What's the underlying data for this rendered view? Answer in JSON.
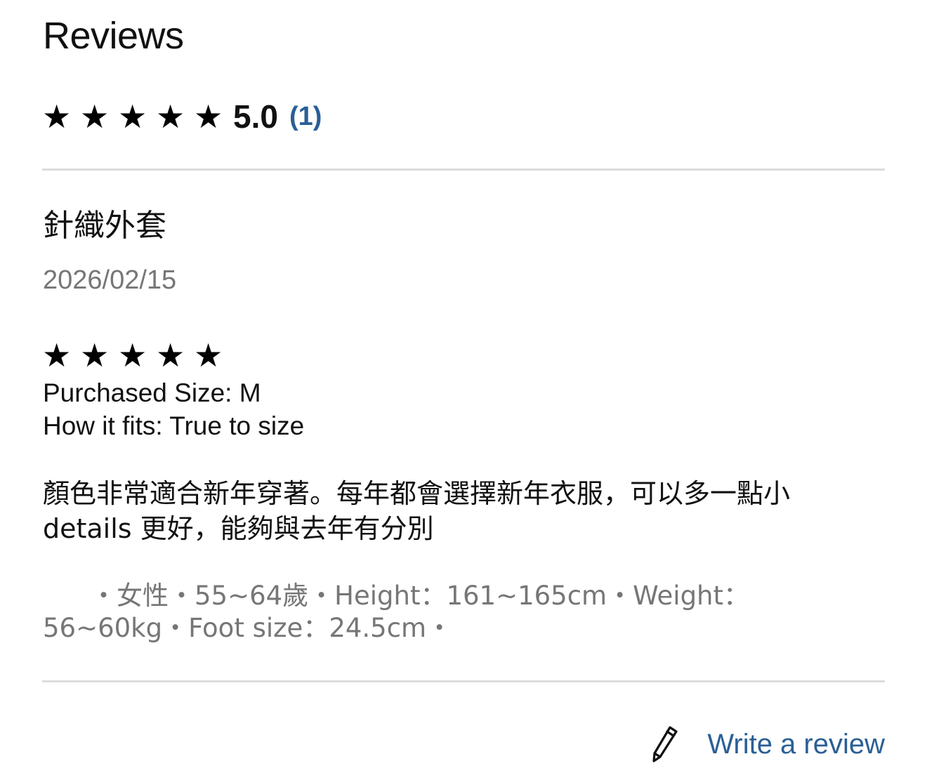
{
  "header": {
    "title": "Reviews"
  },
  "summary": {
    "rating_value": 5.0,
    "rating_text": "5.0",
    "review_count_text": "(1)",
    "star_glyph": "★",
    "link_color": "#2a5f96"
  },
  "review": {
    "title": "針織外套",
    "date": "2026/02/15",
    "rating_value": 5,
    "purchased_size": "Purchased Size: M",
    "fit": "How it fits: True to size",
    "body": "顏色非常適合新年穿著。每年都會選擇新年衣服，可以多一點小 details 更好，能夠與去年有分別",
    "reviewer_info": "・女性・55~64歲・Height：161~165cm・Weight：56~60kg・Foot size：24.5cm・"
  },
  "footer": {
    "write_review_label": "Write a review",
    "write_review_icon": "pencil-icon"
  }
}
